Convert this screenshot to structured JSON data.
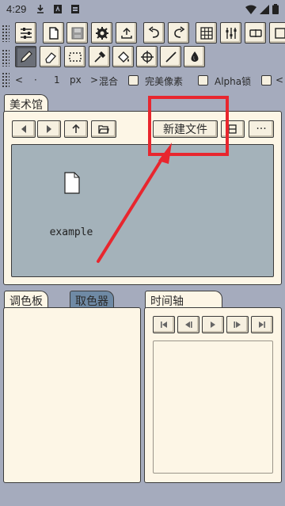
{
  "status_bar": {
    "time": "4:29"
  },
  "brush_row": {
    "left_arrow": "<",
    "dot": "·",
    "size_value": "1",
    "size_unit": "px",
    "right_arrow": ">",
    "blend_label": "混合",
    "pixel_perfect_label": "完美像素",
    "alpha_lock_label": "Alpha锁"
  },
  "gallery": {
    "tab_label": "美术馆",
    "new_file_label": "新建文件",
    "more_label": "···",
    "files": [
      {
        "name": "example"
      }
    ]
  },
  "palette": {
    "tab_label": "调色板"
  },
  "color_picker": {
    "tab_label": "取色器"
  },
  "timeline": {
    "tab_label": "时间轴"
  },
  "colors": {
    "background": "#a5abbd",
    "panel": "#fdf6e6",
    "file_area": "#a4b2ba",
    "annotation": "#e8262e"
  }
}
